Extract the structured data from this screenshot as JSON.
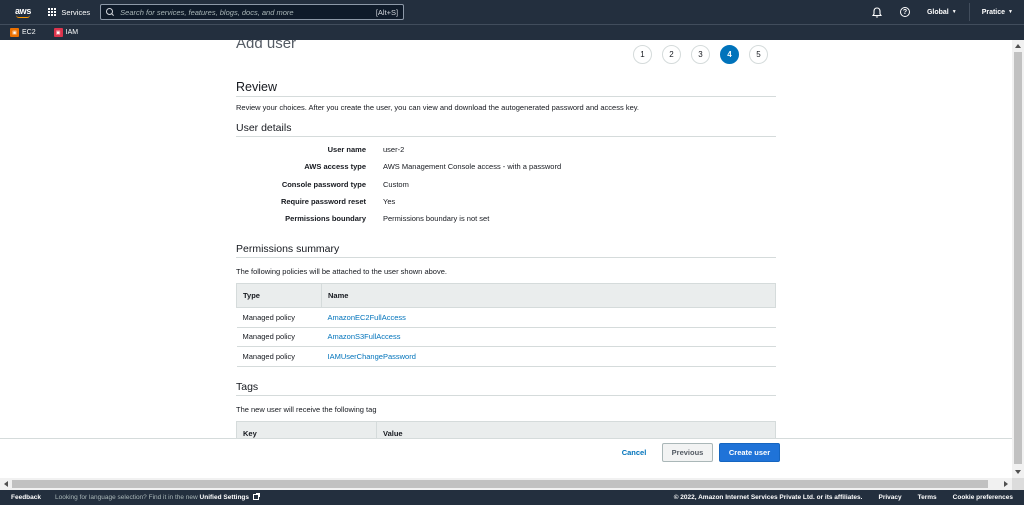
{
  "topnav": {
    "logo_text": "aws",
    "services_label": "Services",
    "search_placeholder": "Search for services, features, blogs, docs, and more",
    "search_shortcut": "[Alt+S]",
    "region_label": "Global",
    "account_label": "Pratice"
  },
  "favorites": [
    {
      "label": "EC2",
      "color": "#ed7100",
      "icon": "ec2-icon"
    },
    {
      "label": "IAM",
      "color": "#dd344c",
      "icon": "iam-icon"
    }
  ],
  "page": {
    "title": "Add user",
    "steps": [
      "1",
      "2",
      "3",
      "4",
      "5"
    ],
    "active_step": "4"
  },
  "review": {
    "heading": "Review",
    "description": "Review your choices. After you create the user, you can view and download the autogenerated password and access key."
  },
  "user_details": {
    "heading": "User details",
    "rows": [
      {
        "label": "User name",
        "value": "user-2"
      },
      {
        "label": "AWS access type",
        "value": "AWS Management Console access - with a password"
      },
      {
        "label": "Console password type",
        "value": "Custom"
      },
      {
        "label": "Require password reset",
        "value": "Yes"
      },
      {
        "label": "Permissions boundary",
        "value": "Permissions boundary is not set"
      }
    ]
  },
  "permissions": {
    "heading": "Permissions summary",
    "description": "The following policies will be attached to the user shown above.",
    "columns": [
      "Type",
      "Name"
    ],
    "rows": [
      {
        "type": "Managed policy",
        "name": "AmazonEC2FullAccess"
      },
      {
        "type": "Managed policy",
        "name": "AmazonS3FullAccess"
      },
      {
        "type": "Managed policy",
        "name": "IAMUserChangePassword"
      }
    ]
  },
  "tags": {
    "heading": "Tags",
    "description": "The new user will receive the following tag",
    "columns": [
      "Key",
      "Value"
    ]
  },
  "actions": {
    "cancel": "Cancel",
    "previous": "Previous",
    "create": "Create user"
  },
  "footer": {
    "feedback": "Feedback",
    "lang_prefix": "Looking for language selection? Find it in the new",
    "lang_link": "Unified Settings",
    "copyright": "© 2022, Amazon Internet Services Private Ltd. or its affiliates.",
    "privacy": "Privacy",
    "terms": "Terms",
    "cookies": "Cookie preferences"
  },
  "colors": {
    "nav_bg": "#232f3e",
    "primary": "#1f73d8",
    "link": "#0073bb",
    "active_step": "#0073bb"
  }
}
